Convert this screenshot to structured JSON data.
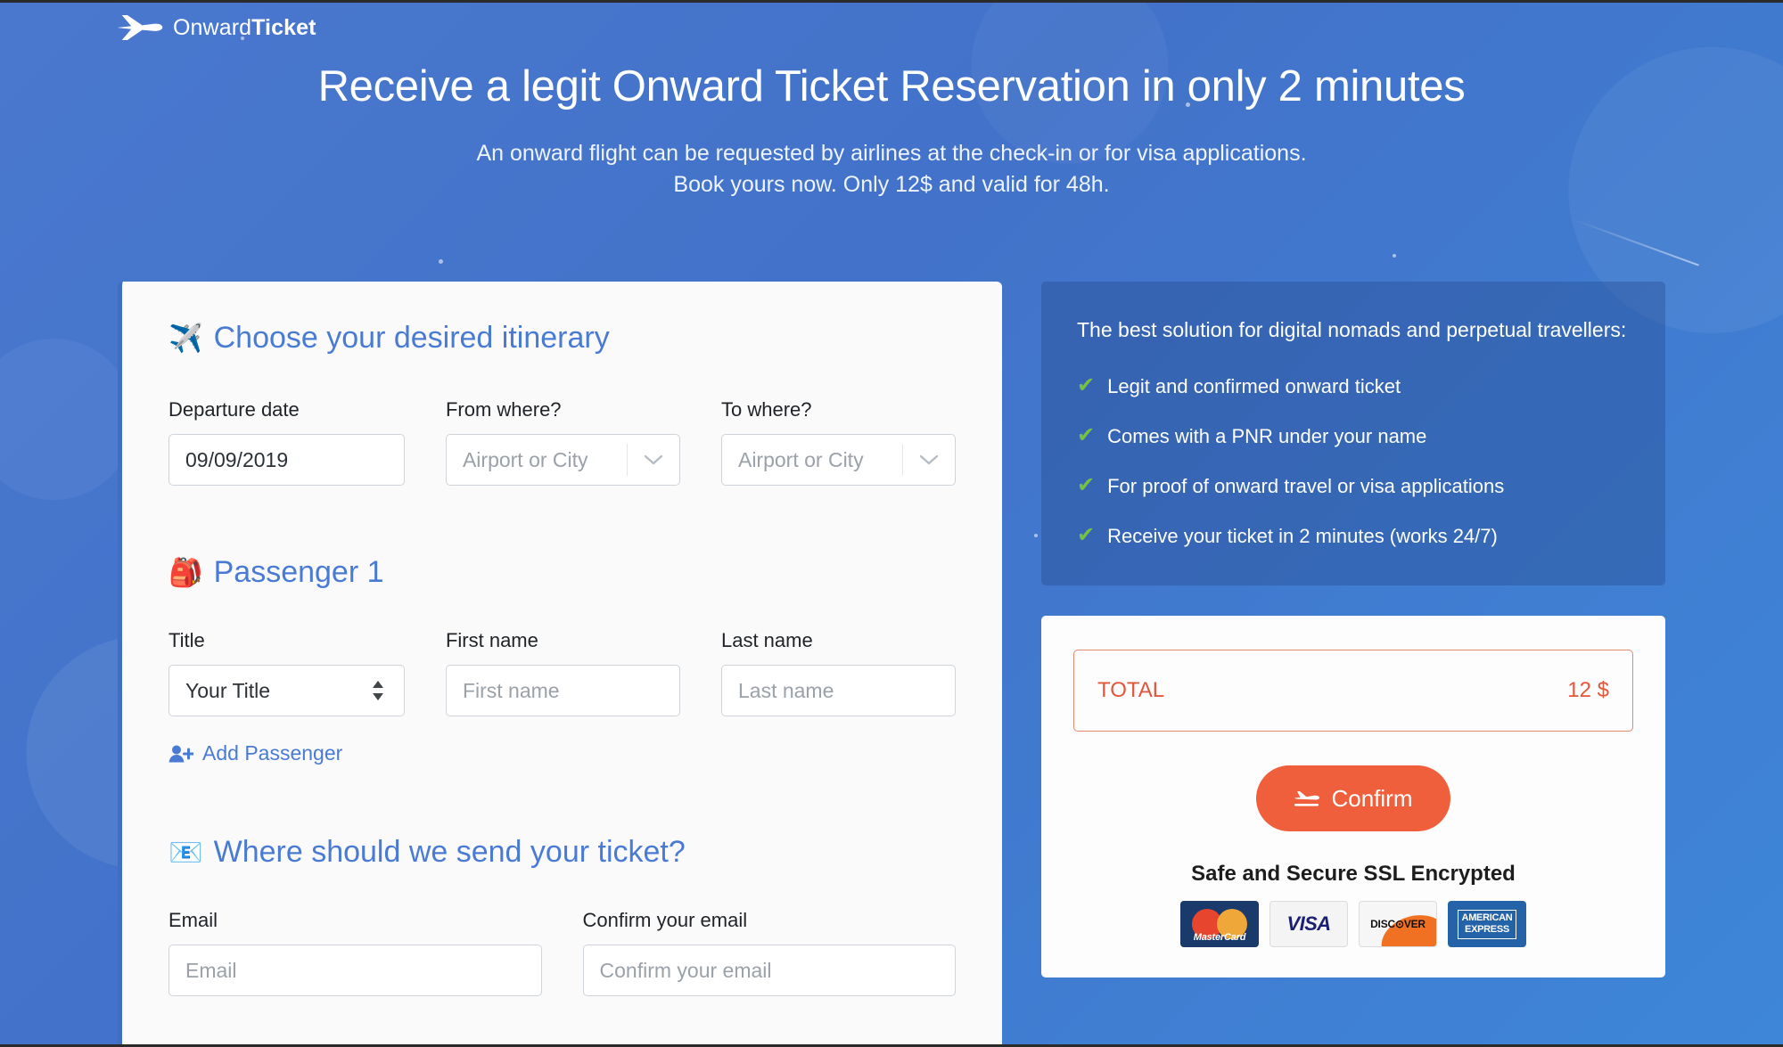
{
  "brand": {
    "name_light": "Onward",
    "name_bold": "Ticket",
    "plane_icon": "airplane-icon"
  },
  "hero": {
    "title": "Receive a legit Onward Ticket Reservation in only 2 minutes",
    "subtitle_line1": "An onward flight can be requested by airlines at the check-in or for visa applications.",
    "subtitle_line2": "Book yours now. Only 12$ and valid for 48h."
  },
  "form": {
    "itinerary": {
      "emoji": "✈️",
      "heading": "Choose your desired itinerary",
      "departure_label": "Departure date",
      "departure_value": "09/09/2019",
      "from_label": "From where?",
      "from_placeholder": "Airport or City",
      "to_label": "To where?",
      "to_placeholder": "Airport or City"
    },
    "passenger": {
      "emoji": "🎒",
      "heading": "Passenger 1",
      "title_label": "Title",
      "title_value": "Your Title",
      "first_label": "First name",
      "first_placeholder": "First name",
      "last_label": "Last name",
      "last_placeholder": "Last name",
      "add_passenger": "Add Passenger"
    },
    "delivery": {
      "emoji": "📧",
      "heading": "Where should we send your ticket?",
      "email_label": "Email",
      "email_placeholder": "Email",
      "confirm_email_label": "Confirm your email",
      "confirm_email_placeholder": "Confirm your email"
    }
  },
  "benefits": {
    "lead": "The best solution for digital nomads and perpetual travellers:",
    "items": [
      "Legit and confirmed onward ticket",
      "Comes with a PNR under your name",
      "For proof of onward travel or visa applications",
      "Receive your ticket in 2 minutes (works 24/7)"
    ],
    "check_color": "#77c043"
  },
  "checkout": {
    "total_label": "TOTAL",
    "total_value": "12 $",
    "confirm_label": "Confirm",
    "ssl_text": "Safe and Secure SSL Encrypted",
    "accent_color": "#ef5f3c",
    "cards": [
      {
        "name": "MasterCard",
        "word": "MasterCard"
      },
      {
        "name": "VISA",
        "word": "VISA"
      },
      {
        "name": "DISCOVER",
        "word": "DISC⊙VER"
      },
      {
        "name": "American Express",
        "word_top": "AMERICAN",
        "word_bottom": "EXPRESS"
      }
    ]
  }
}
